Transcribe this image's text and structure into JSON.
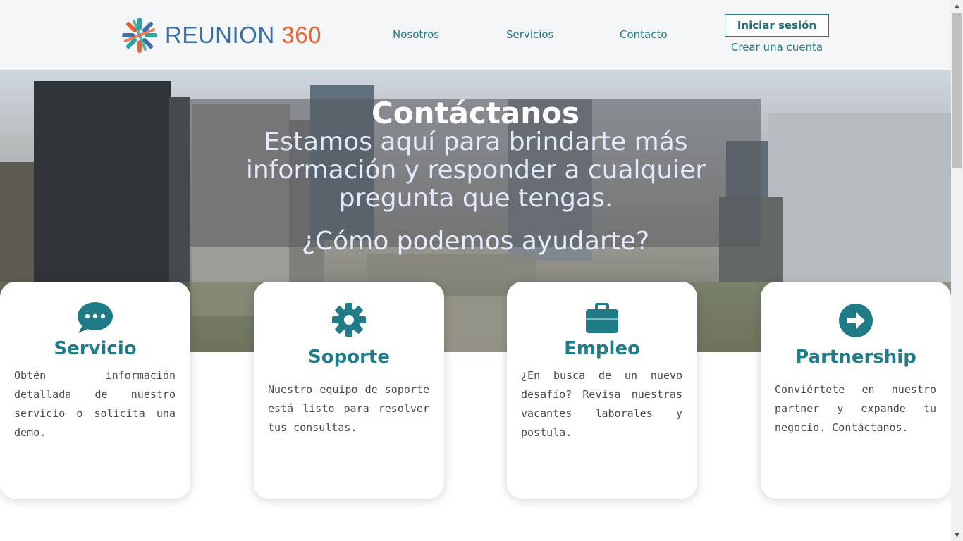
{
  "header": {
    "brand_part1": "REUNION",
    "brand_part2": "360",
    "nav": [
      "Nosotros",
      "Servicios",
      "Contacto"
    ],
    "login_label": "Iniciar sesión",
    "signup_label": "Crear una cuenta"
  },
  "hero": {
    "title": "Contáctanos",
    "subtitle": "Estamos aquí para brindarte más información y responder a cualquier pregunta que tengas.",
    "question": "¿Cómo podemos ayudarte?"
  },
  "cards": [
    {
      "icon": "chat-bubble-icon",
      "title": "Servicio",
      "desc": "Obtén información detallada de nuestro servicio o solicita una demo."
    },
    {
      "icon": "gear-icon",
      "title": "Soporte",
      "desc": "Nuestro equipo de soporte está listo para resolver tus consultas."
    },
    {
      "icon": "briefcase-icon",
      "title": "Empleo",
      "desc": "¿En busca de un nuevo desafío? Revisa nuestras vacantes laborales y postula."
    },
    {
      "icon": "arrow-right-circle-icon",
      "title": "Partnership",
      "desc": "Conviértete en nuestro partner y expande tu negocio. Contáctanos."
    }
  ],
  "colors": {
    "accent_teal": "#1f7c87",
    "brand_blue": "#3c6fa8",
    "brand_orange": "#e8633a"
  }
}
